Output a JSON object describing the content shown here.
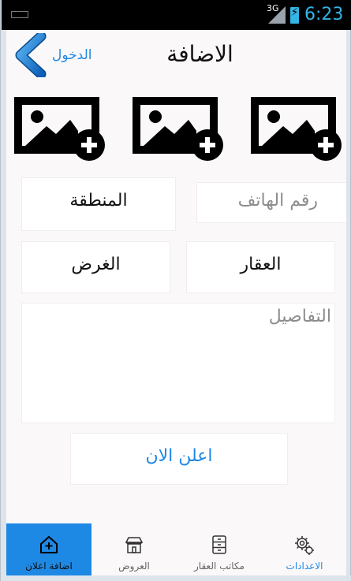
{
  "status_bar": {
    "network": "3G",
    "time": "6:23"
  },
  "header": {
    "login_label": "الدخول",
    "title": "الاضافة"
  },
  "image_slots": [
    "add-image-icon",
    "add-image-icon",
    "add-image-icon"
  ],
  "form": {
    "phone_placeholder": "رقم الهاتف",
    "region_label": "المنطقة",
    "property_label": "العقار",
    "purpose_label": "الغرض",
    "details_placeholder": "التفاصيل",
    "submit_label": "اعلن الان"
  },
  "bottom_nav": {
    "add_ad": "اضافة اعلان",
    "offers": "العروض",
    "offices": "مكاتب العقار",
    "settings": "الاعدادات"
  },
  "colors": {
    "accent": "#1e88e5",
    "status_blue": "#33b5e5"
  }
}
